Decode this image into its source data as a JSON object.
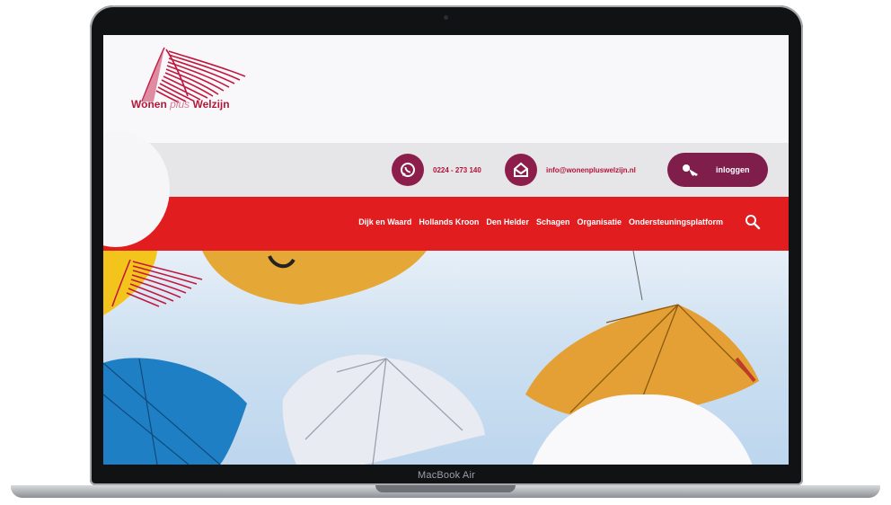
{
  "device": {
    "model_label": "MacBook Air"
  },
  "site": {
    "logo": {
      "word1": "Wonen",
      "word2": "plus",
      "word3": "Welzijn"
    },
    "contact": {
      "phone": "0224 - 273 140",
      "email": "info@wonenpluswelzijn.nl"
    },
    "login_label": "inloggen",
    "nav": [
      "Dijk en Waard",
      "Hollands Kroon",
      "Den Helder",
      "Schagen",
      "Organisatie",
      "Ondersteuningsplatform"
    ],
    "colors": {
      "brand_red": "#e11d20",
      "brand_plum": "#7f1d4b"
    }
  }
}
